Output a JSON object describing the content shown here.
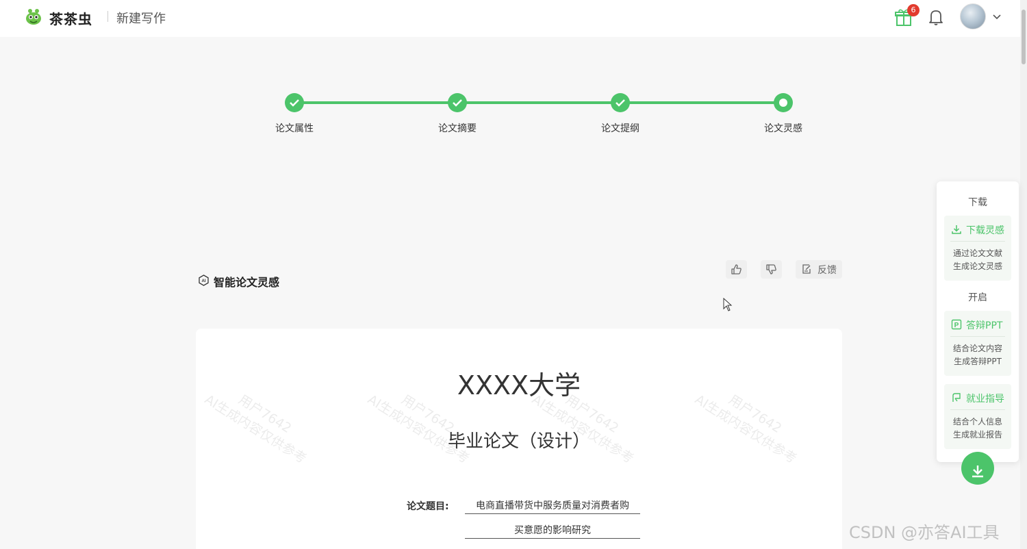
{
  "header": {
    "brand": "茶茶虫",
    "page_name": "新建写作",
    "gift_badge": "6"
  },
  "steps": [
    {
      "label": "论文属性",
      "state": "done"
    },
    {
      "label": "论文摘要",
      "state": "done"
    },
    {
      "label": "论文提纲",
      "state": "done"
    },
    {
      "label": "论文灵感",
      "state": "current"
    }
  ],
  "section": {
    "title": "智能论文灵感",
    "feedback_label": "反馈"
  },
  "document": {
    "university": "XXXX大学",
    "subtitle": "毕业论文（设计）",
    "topic_label": "论文题目:",
    "topic_line1": "电商直播带货中服务质量对消费者购",
    "topic_line2": "买意愿的影响研究",
    "watermark_line1": "用户7642",
    "watermark_line2": "AI生成内容仅供参考"
  },
  "side_panel": {
    "download_heading": "下载",
    "download_card": {
      "title": "下载灵感",
      "desc1": "通过论文文献",
      "desc2": "生成论文灵感"
    },
    "open_heading": "开启",
    "ppt_card": {
      "title": "答辩PPT",
      "desc1": "结合论文内容",
      "desc2": "生成答辩PPT"
    },
    "job_card": {
      "title": "就业指导",
      "desc1": "结合个人信息",
      "desc2": "生成就业报告"
    }
  },
  "overlay_watermark": "CSDN @亦答AI工具",
  "colors": {
    "accent": "#4cc46a",
    "badge": "#e23b2e"
  }
}
